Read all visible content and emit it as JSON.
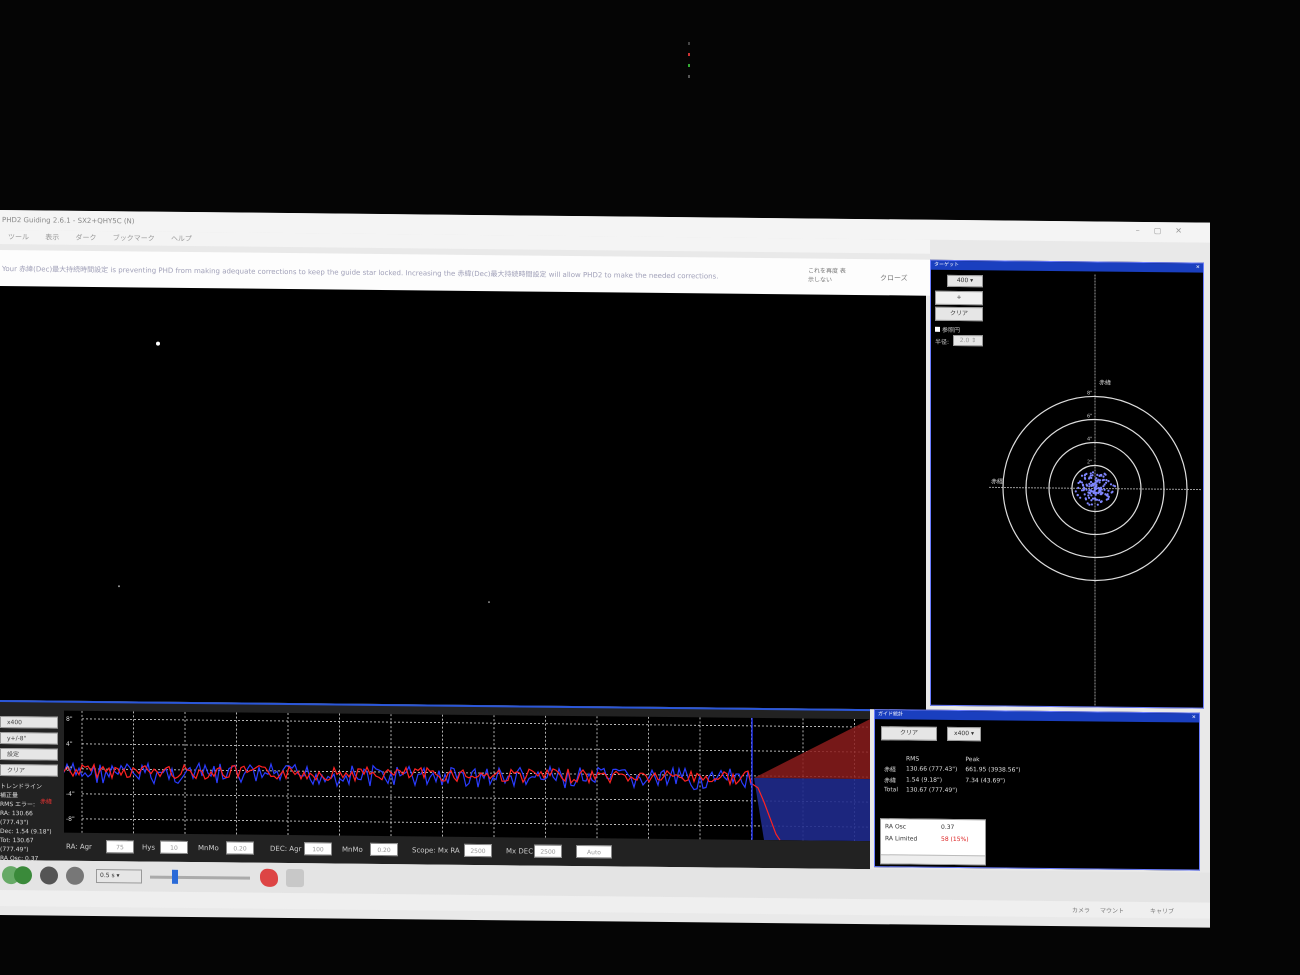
{
  "window": {
    "title": "PHD2 Guiding 2.6.1 - SX2+QHY5C (N)",
    "menu": [
      "ツール",
      "表示",
      "ダーク",
      "ブックマーク",
      "ヘルプ"
    ]
  },
  "alert": {
    "message": "Your 赤緯(Dec)最大持続時間設定 is preventing PHD from making adequate corrections to keep the guide star locked. Increasing the 赤緯(Dec)最大持続時間設定 will allow PHD2 to make the needed corrections.",
    "dont_show_label": "これを再度 表示しない",
    "close_label": "クローズ"
  },
  "target_panel": {
    "title": "ターゲット",
    "scale_value": "400",
    "zoom_label": "+",
    "clear_label": "クリア",
    "reference_circle_label": "参照円",
    "radius_label": "半径:",
    "radius_value": "2.0",
    "axis_labels": {
      "dec": "赤緯",
      "ra": "赤経"
    },
    "ring_labels": [
      "8\"",
      "6\"",
      "4\"",
      "2\""
    ]
  },
  "graph_panel": {
    "buttons": [
      "x400",
      "y+/-8\"",
      "設定",
      "クリア"
    ],
    "stats_lines": [
      "トレンドライン",
      "補正量",
      "RMS エラー:",
      "RA: 130.66 (777.43\")",
      "Dec: 1.54 (9.18\")",
      "Tot: 130.67 (777.49\")",
      "RA Osc: 0.37"
    ],
    "y_labels": [
      "8\"",
      "4\"",
      "0\"",
      "-4\"",
      "-8\""
    ],
    "dec_label": "赤緯",
    "ra_agr": {
      "label": "RA: Agr",
      "value": "75"
    },
    "hys": {
      "label": "Hys",
      "value": "10"
    },
    "minmo1": {
      "label": "MnMo",
      "value": "0.20"
    },
    "dec_agr": {
      "label": "DEC: Agr",
      "value": "100"
    },
    "minmo2": {
      "label": "MnMo",
      "value": "0.20"
    },
    "max_ra": {
      "label": "Scope: Mx RA",
      "value": "2500"
    },
    "max_dec": {
      "label": "Mx DEC",
      "value": "2500"
    },
    "mode": "Auto",
    "colors": {
      "ra": "#ff2222",
      "dec": "#2a3cff"
    }
  },
  "stats_panel": {
    "title": "ガイド統計",
    "clear_label": "クリア",
    "scale_value": "x400",
    "headers": [
      "",
      "RMS",
      "Peak"
    ],
    "rows": [
      [
        "赤経",
        "130.66 (777.43\")",
        "661.95 (3938.56\")"
      ],
      [
        "赤緯",
        "1.54 (9.18\")",
        "7.34 (43.69\")"
      ],
      [
        "Total",
        "130.67 (777.49\")",
        ""
      ]
    ],
    "osc_label": "RA Osc",
    "osc_value": "0.37",
    "limited_label": "RA Limited",
    "limited_value": "58 (15%)"
  },
  "toolbar": {
    "exposure": "0.5 s"
  },
  "statusbar": {
    "items": [
      "カメラ",
      "マウント",
      "キャリブ"
    ]
  }
}
